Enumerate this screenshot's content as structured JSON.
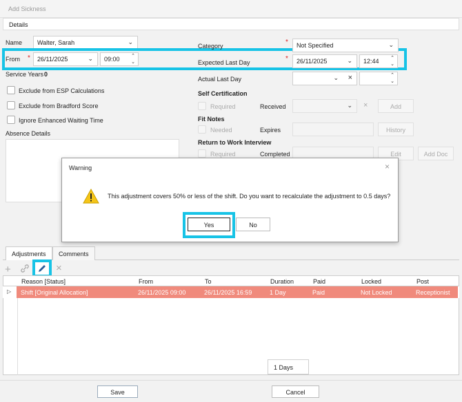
{
  "window": {
    "title": "Add Sickness"
  },
  "details": {
    "header": "Details"
  },
  "left": {
    "name_label": "Name",
    "name_value": "Walter, Sarah",
    "from_label": "From",
    "from_date": "26/11/2025",
    "from_time": "09:00",
    "service_years_label": "Service Years",
    "service_years_value": "0",
    "checkbox_esp": "Exclude from ESP Calculations",
    "checkbox_bradford": "Exclude from Bradford Score",
    "checkbox_waiting": "Ignore Enhanced Waiting Time",
    "absence_details_label": "Absence Details"
  },
  "right": {
    "category_label": "Category",
    "category_value": "Not Specified",
    "expected_label": "Expected Last Day",
    "expected_date": "26/11/2025",
    "expected_time": "12:44",
    "actual_label": "Actual Last Day",
    "self_cert_label": "Self Certification",
    "self_required": "Required",
    "self_received": "Received",
    "add_button": "Add",
    "fit_notes_label": "Fit Notes",
    "fit_needed": "Needed",
    "fit_expires": "Expires",
    "history_button": "History",
    "rtw_label": "Return to Work Interview",
    "rtw_required": "Required",
    "rtw_completed": "Completed",
    "edit_button": "Edit",
    "add_doc_button": "Add Doc"
  },
  "required_mark": "*",
  "dialog": {
    "title": "Warning",
    "message": "This adjustment covers 50% or less of the shift. Do you want to recalculate the adjustment to  0.5 days?",
    "yes": "Yes",
    "no": "No"
  },
  "tabs": [
    {
      "label": "Adjustments",
      "active": true
    },
    {
      "label": "Comments",
      "active": false
    }
  ],
  "grid": {
    "columns": [
      "Reason [Status]",
      "From",
      "To",
      "Duration",
      "Paid",
      "Locked",
      "Post"
    ],
    "rows": [
      [
        "Shift [Original Allocation]",
        "26/11/2025 09:00",
        "26/11/2025 16:59",
        "1 Day",
        "Paid",
        "Not Locked",
        "Receptionist"
      ]
    ],
    "row_color": "#f08a7c"
  },
  "total": "1 Days",
  "footer": {
    "save": "Save",
    "cancel": "Cancel"
  },
  "colors": {
    "highlight": "#17c3e6",
    "required": "#dd2222"
  }
}
